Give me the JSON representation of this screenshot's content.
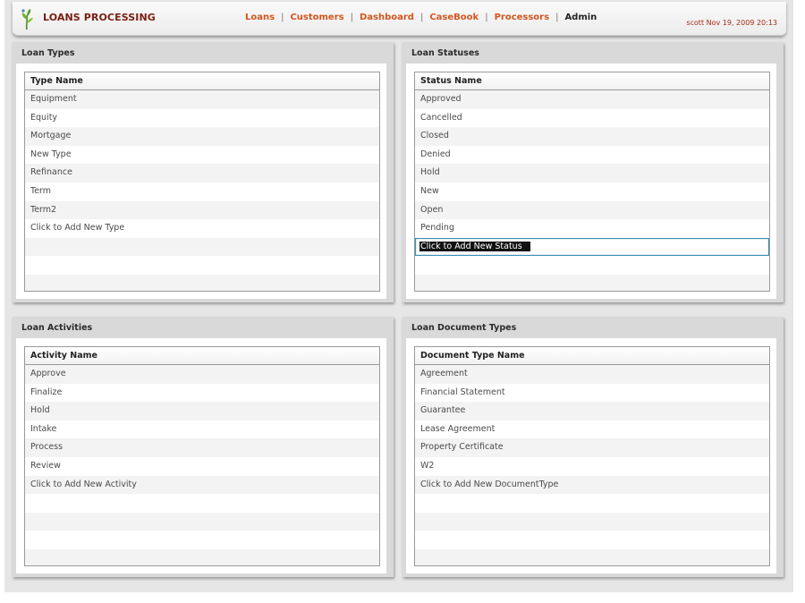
{
  "header": {
    "brand": "LOANS PROCESSING",
    "nav": [
      {
        "label": "Loans"
      },
      {
        "label": "Customers"
      },
      {
        "label": "Dashboard"
      },
      {
        "label": "CaseBook"
      },
      {
        "label": "Processors"
      },
      {
        "label": "Admin",
        "active": true
      }
    ],
    "user_info": "scott Nov 19, 2009 20:13"
  },
  "panels": {
    "loan_types": {
      "title": "Loan Types",
      "column": "Type Name",
      "rows": [
        "Equipment",
        "Equity",
        "Mortgage",
        "New Type",
        "Refinance",
        "Term",
        "Term2",
        "Click to Add New Type"
      ]
    },
    "loan_statuses": {
      "title": "Loan Statuses",
      "column": "Status Name",
      "rows": [
        "Approved",
        "Cancelled",
        "Closed",
        "Denied",
        "Hold",
        "New",
        "Open",
        "Pending"
      ],
      "editing_value": "Click to Add New Status"
    },
    "loan_activities": {
      "title": "Loan Activities",
      "column": "Activity Name",
      "rows": [
        "Approve",
        "Finalize",
        "Hold",
        "Intake",
        "Process",
        "Review",
        "Click to Add New Activity"
      ]
    },
    "loan_document_types": {
      "title": "Loan Document Types",
      "column": "Document Type Name",
      "rows": [
        "Agreement",
        "Financial Statement",
        "Guarantee",
        "Lease Agreement",
        "Property Certificate",
        "W2",
        "Click to Add New DocumentType"
      ]
    }
  },
  "colors": {
    "brand": "#7a1e12",
    "nav_link": "#d2561e",
    "nav_active": "#222222",
    "edit_border": "#3b8fb3"
  }
}
